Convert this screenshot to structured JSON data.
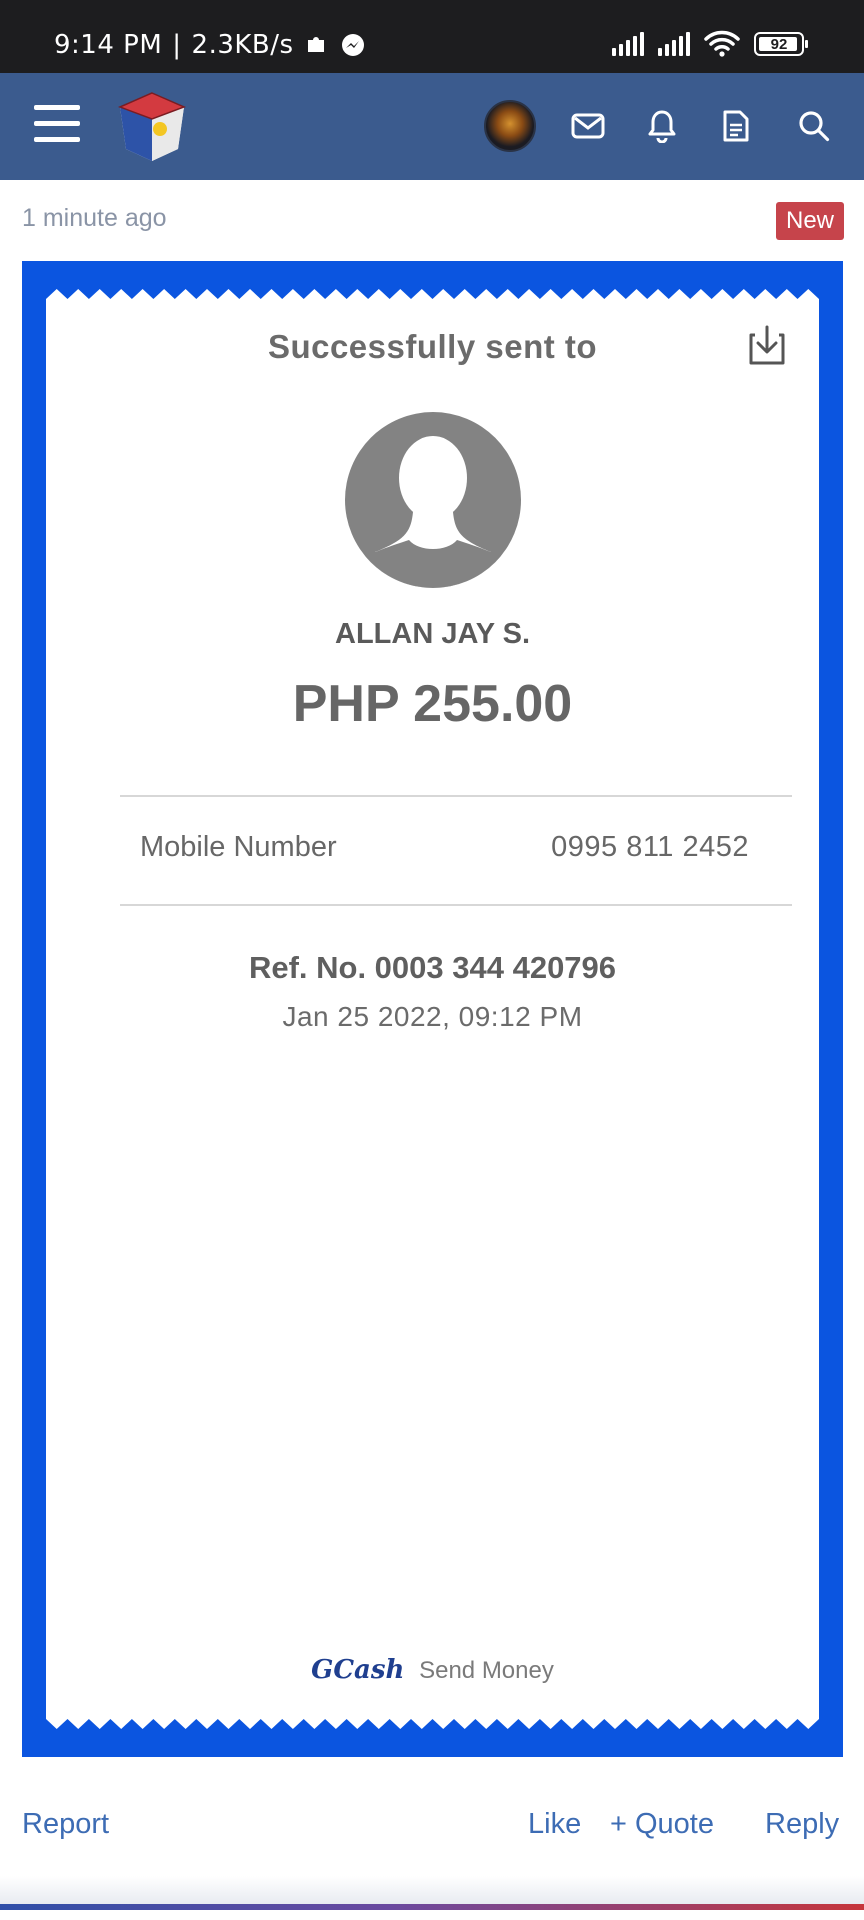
{
  "status_bar": {
    "time": "9:14 PM",
    "separator": "|",
    "speed": "2.3KB/s",
    "battery": "92"
  },
  "header": {
    "menu_icon": "hamburger-icon",
    "logo_icon": "logo-icon",
    "avatar_icon": "user-avatar",
    "icons": [
      "mail-icon",
      "bell-icon",
      "document-icon",
      "search-icon"
    ]
  },
  "post": {
    "time_ago": "1 minute ago",
    "badge": "New"
  },
  "receipt": {
    "title": "Successfully sent to",
    "recipient_name": "ALLAN JAY S.",
    "amount": "PHP 255.00",
    "mobile_label": "Mobile Number",
    "mobile_value": "0995 811 2452",
    "ref_no": "Ref. No. 0003 344 420796",
    "datetime": "Jan 25 2022, 09:12 PM",
    "brand": "GCash",
    "brand_caption": "Send Money",
    "frame_color": "#0b55e0"
  },
  "actions": {
    "report": "Report",
    "like": "Like",
    "quote": "+ Quote",
    "reply": "Reply"
  }
}
